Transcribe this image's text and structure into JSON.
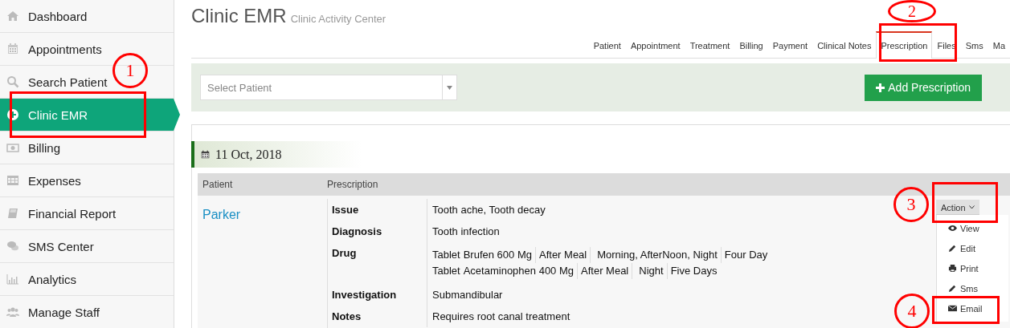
{
  "sidebar": {
    "items": [
      {
        "label": "Dashboard",
        "selected": false
      },
      {
        "label": "Appointments",
        "selected": false
      },
      {
        "label": "Search Patient",
        "selected": false
      },
      {
        "label": "Clinic EMR",
        "selected": true
      },
      {
        "label": "Billing",
        "selected": false
      },
      {
        "label": "Expenses",
        "selected": false
      },
      {
        "label": "Financial Report",
        "selected": false
      },
      {
        "label": "SMS Center",
        "selected": false
      },
      {
        "label": "Analytics",
        "selected": false
      },
      {
        "label": "Manage Staff",
        "selected": false
      }
    ]
  },
  "header": {
    "title": "Clinic EMR",
    "subtitle": "Clinic Activity Center"
  },
  "tabs": [
    {
      "label": "Patient",
      "selected": false
    },
    {
      "label": "Appointment",
      "selected": false
    },
    {
      "label": "Treatment",
      "selected": false
    },
    {
      "label": "Billing",
      "selected": false
    },
    {
      "label": "Payment",
      "selected": false
    },
    {
      "label": "Clinical Notes",
      "selected": false
    },
    {
      "label": "Prescription",
      "selected": true
    },
    {
      "label": "Files",
      "selected": false
    },
    {
      "label": "Sms",
      "selected": false
    },
    {
      "label": "Ma",
      "selected": false
    }
  ],
  "toolbar": {
    "patient_select": {
      "placeholder": "Select Patient"
    },
    "add_button": "Add Prescription"
  },
  "record": {
    "date": "11 Oct, 2018",
    "table": {
      "columns": [
        "Patient",
        "Prescription"
      ],
      "patient": "Parker",
      "fields": [
        {
          "label": "Issue",
          "value": "Tooth ache, Tooth decay"
        },
        {
          "label": "Diagnosis",
          "value": "Tooth infection"
        },
        {
          "label": "Drug",
          "drugs": [
            {
              "form": "Tablet",
              "name": "Brufen 600 Mg",
              "parts": [
                "After Meal",
                "Morning, AfterNoon, Night",
                "Four Day"
              ]
            },
            {
              "form": "Tablet",
              "name": "Acetaminophen 400 Mg",
              "parts": [
                "After Meal",
                "Night",
                "Five Days"
              ]
            }
          ]
        },
        {
          "label": "Investigation",
          "value": "Submandibular"
        },
        {
          "label": "Notes",
          "value": "Requires root canal treatment"
        }
      ]
    },
    "action": {
      "label": "Action",
      "expanded": true,
      "menu": [
        "View",
        "Edit",
        "Print",
        "Sms",
        "Email"
      ]
    }
  },
  "annotations": [
    {
      "number": "1"
    },
    {
      "number": "2"
    },
    {
      "number": "3"
    },
    {
      "number": "4"
    }
  ]
}
